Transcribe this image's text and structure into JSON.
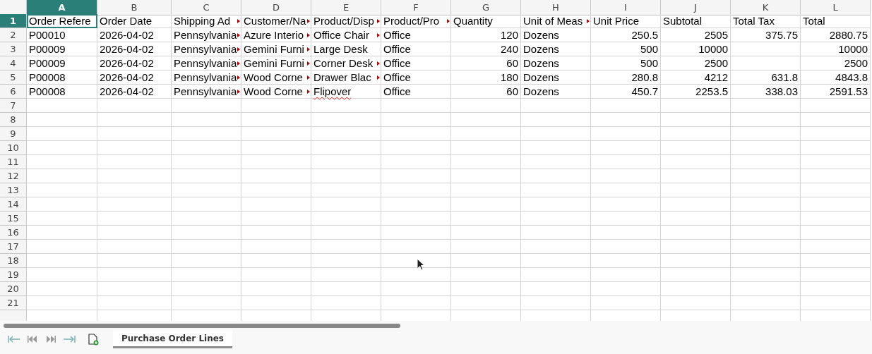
{
  "columns": [
    {
      "letter": "A",
      "selected": true
    },
    {
      "letter": "B",
      "selected": false
    },
    {
      "letter": "C",
      "selected": false
    },
    {
      "letter": "D",
      "selected": false
    },
    {
      "letter": "E",
      "selected": false
    },
    {
      "letter": "F",
      "selected": false
    },
    {
      "letter": "G",
      "selected": false
    },
    {
      "letter": "H",
      "selected": false
    },
    {
      "letter": "I",
      "selected": false
    },
    {
      "letter": "J",
      "selected": false
    },
    {
      "letter": "K",
      "selected": false
    },
    {
      "letter": "L",
      "selected": false
    }
  ],
  "rows": [
    {
      "number": "1",
      "selected": true,
      "cells": [
        {
          "text": "Order Refere",
          "kind": "text",
          "selected": true,
          "overflow": false
        },
        {
          "text": "Order Date",
          "kind": "text",
          "selected": false,
          "overflow": false
        },
        {
          "text": "Shipping Ad",
          "kind": "text",
          "selected": false,
          "overflow": true
        },
        {
          "text": "Customer/Na",
          "kind": "text",
          "selected": false,
          "overflow": true
        },
        {
          "text": "Product/Disp",
          "kind": "text",
          "selected": false,
          "overflow": true
        },
        {
          "text": "Product/Pro",
          "kind": "text",
          "selected": false,
          "overflow": true
        },
        {
          "text": "Quantity",
          "kind": "text",
          "selected": false,
          "overflow": false
        },
        {
          "text": "Unit of Meas",
          "kind": "text",
          "selected": false,
          "overflow": true
        },
        {
          "text": "Unit Price",
          "kind": "text",
          "selected": false,
          "overflow": false
        },
        {
          "text": "Subtotal",
          "kind": "text",
          "selected": false,
          "overflow": false
        },
        {
          "text": "Total Tax",
          "kind": "text",
          "selected": false,
          "overflow": false
        },
        {
          "text": "Total",
          "kind": "text",
          "selected": false,
          "overflow": false
        }
      ]
    },
    {
      "number": "2",
      "selected": false,
      "cells": [
        {
          "text": "P00010",
          "kind": "text",
          "selected": false,
          "overflow": false
        },
        {
          "text": "2026-04-02",
          "kind": "text",
          "selected": false,
          "overflow": false
        },
        {
          "text": "Pennsylvania",
          "kind": "text",
          "selected": false,
          "overflow": true
        },
        {
          "text": "Azure Interio",
          "kind": "text",
          "selected": false,
          "overflow": true
        },
        {
          "text": "Office Chair",
          "kind": "text",
          "selected": false,
          "overflow": true
        },
        {
          "text": "Office",
          "kind": "text",
          "selected": false,
          "overflow": false
        },
        {
          "text": "120",
          "kind": "number",
          "selected": false,
          "overflow": false
        },
        {
          "text": "Dozens",
          "kind": "text",
          "selected": false,
          "overflow": false
        },
        {
          "text": "250.5",
          "kind": "number",
          "selected": false,
          "overflow": false
        },
        {
          "text": "2505",
          "kind": "number",
          "selected": false,
          "overflow": false
        },
        {
          "text": "375.75",
          "kind": "number",
          "selected": false,
          "overflow": false
        },
        {
          "text": "2880.75",
          "kind": "number",
          "selected": false,
          "overflow": false
        }
      ]
    },
    {
      "number": "3",
      "selected": false,
      "cells": [
        {
          "text": "P00009",
          "kind": "text",
          "selected": false,
          "overflow": false
        },
        {
          "text": "2026-04-02",
          "kind": "text",
          "selected": false,
          "overflow": false
        },
        {
          "text": "Pennsylvania",
          "kind": "text",
          "selected": false,
          "overflow": true
        },
        {
          "text": "Gemini Furni",
          "kind": "text",
          "selected": false,
          "overflow": true
        },
        {
          "text": "Large Desk",
          "kind": "text",
          "selected": false,
          "overflow": false
        },
        {
          "text": "Office",
          "kind": "text",
          "selected": false,
          "overflow": false
        },
        {
          "text": "240",
          "kind": "number",
          "selected": false,
          "overflow": false
        },
        {
          "text": "Dozens",
          "kind": "text",
          "selected": false,
          "overflow": false
        },
        {
          "text": "500",
          "kind": "number",
          "selected": false,
          "overflow": false
        },
        {
          "text": "10000",
          "kind": "number",
          "selected": false,
          "overflow": false
        },
        null,
        {
          "text": "10000",
          "kind": "number",
          "selected": false,
          "overflow": false
        }
      ]
    },
    {
      "number": "4",
      "selected": false,
      "cells": [
        {
          "text": "P00009",
          "kind": "text",
          "selected": false,
          "overflow": false
        },
        {
          "text": "2026-04-02",
          "kind": "text",
          "selected": false,
          "overflow": false
        },
        {
          "text": "Pennsylvania",
          "kind": "text",
          "selected": false,
          "overflow": true
        },
        {
          "text": "Gemini Furni",
          "kind": "text",
          "selected": false,
          "overflow": true
        },
        {
          "text": "Corner Desk",
          "kind": "text",
          "selected": false,
          "overflow": true
        },
        {
          "text": "Office",
          "kind": "text",
          "selected": false,
          "overflow": false
        },
        {
          "text": "60",
          "kind": "number",
          "selected": false,
          "overflow": false
        },
        {
          "text": "Dozens",
          "kind": "text",
          "selected": false,
          "overflow": false
        },
        {
          "text": "500",
          "kind": "number",
          "selected": false,
          "overflow": false
        },
        {
          "text": "2500",
          "kind": "number",
          "selected": false,
          "overflow": false
        },
        null,
        {
          "text": "2500",
          "kind": "number",
          "selected": false,
          "overflow": false
        }
      ]
    },
    {
      "number": "5",
      "selected": false,
      "cells": [
        {
          "text": "P00008",
          "kind": "text",
          "selected": false,
          "overflow": false
        },
        {
          "text": "2026-04-02",
          "kind": "text",
          "selected": false,
          "overflow": false
        },
        {
          "text": "Pennsylvania",
          "kind": "text",
          "selected": false,
          "overflow": true
        },
        {
          "text": "Wood Corne",
          "kind": "text",
          "selected": false,
          "overflow": true
        },
        {
          "text": "Drawer Blac",
          "kind": "text",
          "selected": false,
          "overflow": true
        },
        {
          "text": "Office",
          "kind": "text",
          "selected": false,
          "overflow": false
        },
        {
          "text": "180",
          "kind": "number",
          "selected": false,
          "overflow": false
        },
        {
          "text": "Dozens",
          "kind": "text",
          "selected": false,
          "overflow": false
        },
        {
          "text": "280.8",
          "kind": "number",
          "selected": false,
          "overflow": false
        },
        {
          "text": "4212",
          "kind": "number",
          "selected": false,
          "overflow": false
        },
        {
          "text": "631.8",
          "kind": "number",
          "selected": false,
          "overflow": false
        },
        {
          "text": "4843.8",
          "kind": "number",
          "selected": false,
          "overflow": false
        }
      ]
    },
    {
      "number": "6",
      "selected": false,
      "cells": [
        {
          "text": "P00008",
          "kind": "text",
          "selected": false,
          "overflow": false
        },
        {
          "text": "2026-04-02",
          "kind": "text",
          "selected": false,
          "overflow": false
        },
        {
          "text": "Pennsylvania",
          "kind": "text",
          "selected": false,
          "overflow": true
        },
        {
          "text": "Wood Corne",
          "kind": "text",
          "selected": false,
          "overflow": true
        },
        {
          "text": "Flipover",
          "kind": "text",
          "selected": false,
          "overflow": false,
          "misspelled": true
        },
        {
          "text": "Office",
          "kind": "text",
          "selected": false,
          "overflow": false
        },
        {
          "text": "60",
          "kind": "number",
          "selected": false,
          "overflow": false
        },
        {
          "text": "Dozens",
          "kind": "text",
          "selected": false,
          "overflow": false
        },
        {
          "text": "450.7",
          "kind": "number",
          "selected": false,
          "overflow": false
        },
        {
          "text": "2253.5",
          "kind": "number",
          "selected": false,
          "overflow": false
        },
        {
          "text": "338.03",
          "kind": "number",
          "selected": false,
          "overflow": false
        },
        {
          "text": "2591.53",
          "kind": "number",
          "selected": false,
          "overflow": false
        }
      ]
    },
    {
      "number": "7",
      "selected": false,
      "cells": []
    },
    {
      "number": "8",
      "selected": false,
      "cells": []
    },
    {
      "number": "9",
      "selected": false,
      "cells": []
    },
    {
      "number": "10",
      "selected": false,
      "cells": []
    },
    {
      "number": "11",
      "selected": false,
      "cells": []
    },
    {
      "number": "12",
      "selected": false,
      "cells": []
    },
    {
      "number": "13",
      "selected": false,
      "cells": []
    },
    {
      "number": "14",
      "selected": false,
      "cells": []
    },
    {
      "number": "15",
      "selected": false,
      "cells": []
    },
    {
      "number": "16",
      "selected": false,
      "cells": []
    },
    {
      "number": "17",
      "selected": false,
      "cells": []
    },
    {
      "number": "18",
      "selected": false,
      "cells": []
    },
    {
      "number": "19",
      "selected": false,
      "cells": []
    },
    {
      "number": "20",
      "selected": false,
      "cells": []
    },
    {
      "number": "21",
      "selected": false,
      "cells": []
    }
  ],
  "sheet_tabs": [
    {
      "label": "Purchase Order Lines",
      "selected": true
    }
  ]
}
